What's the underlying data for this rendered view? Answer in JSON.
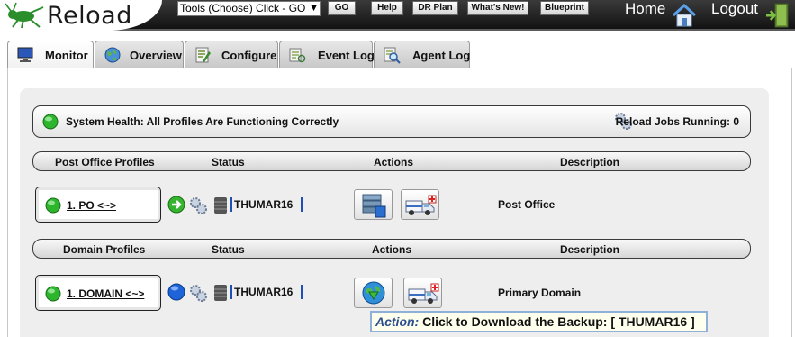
{
  "app": {
    "name": "Reload",
    "tools_select": "Tools (Choose) Click - GO",
    "buttons": {
      "go": "GO",
      "help": "Help",
      "dr_plan": "DR Plan",
      "whats_new": "What's New!",
      "blueprint": "Blueprint"
    },
    "nav": {
      "home": "Home",
      "logout": "Logout"
    }
  },
  "tabs": [
    {
      "label": "Monitor",
      "icon": "monitor-icon",
      "active": true
    },
    {
      "label": "Overview",
      "icon": "globe-icon"
    },
    {
      "label": "Configure",
      "icon": "configure-icon"
    },
    {
      "label": "Event Log",
      "icon": "event-log-icon"
    },
    {
      "label": "Agent Log",
      "icon": "agent-log-icon"
    }
  ],
  "health": {
    "status_text": "System Health: All Profiles Are Functioning Correctly",
    "status_color": "#2db52d",
    "jobs_text": "Reload Jobs Running: 0"
  },
  "post_office": {
    "header": {
      "profiles": "Post Office Profiles",
      "status": "Status",
      "actions": "Actions",
      "description": "Description"
    },
    "rows": [
      {
        "profile": "1. PO <~>",
        "server": "THUMAR16",
        "description": "Post Office",
        "state_color": "#2db52d"
      }
    ]
  },
  "domain": {
    "header": {
      "profiles": "Domain Profiles",
      "status": "Status",
      "actions": "Actions",
      "description": "Description"
    },
    "rows": [
      {
        "profile": "1. DOMAIN <~>",
        "server": "THUMAR16",
        "description": "Primary Domain",
        "state_color": "#2db52d"
      }
    ]
  },
  "tooltip": {
    "lead": "Action:",
    "text": "Click to Download the Backup: [ THUMAR16 ]"
  }
}
